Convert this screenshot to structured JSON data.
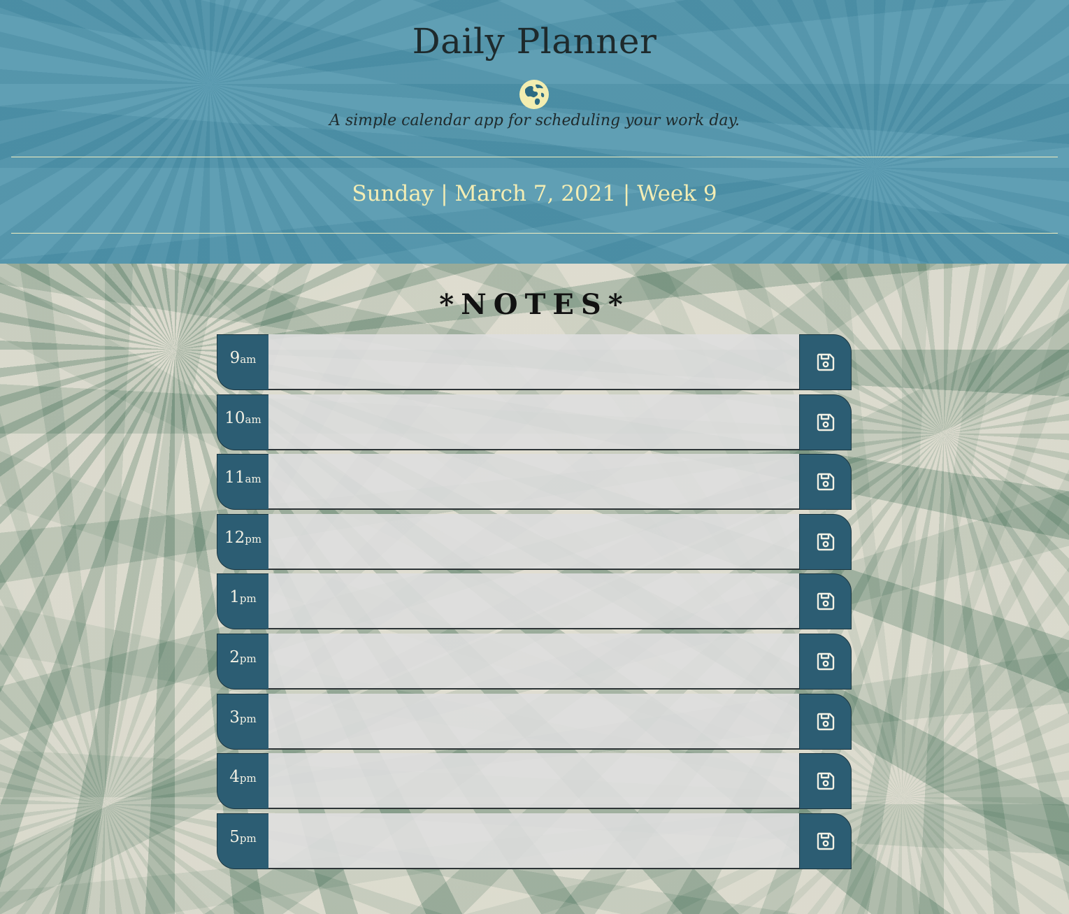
{
  "header": {
    "title": "Daily Planner",
    "icon": "globe-icon",
    "lead": "A simple calendar app for scheduling your work day.",
    "current_day": "Sunday | March 7, 2021 | Week 9"
  },
  "notes": {
    "heading": "*NOTES*"
  },
  "time_blocks": [
    {
      "hour": "9",
      "period": "am",
      "description": ""
    },
    {
      "hour": "10",
      "period": "am",
      "description": ""
    },
    {
      "hour": "11",
      "period": "am",
      "description": ""
    },
    {
      "hour": "12",
      "period": "pm",
      "description": ""
    },
    {
      "hour": "1",
      "period": "pm",
      "description": ""
    },
    {
      "hour": "2",
      "period": "pm",
      "description": ""
    },
    {
      "hour": "3",
      "period": "pm",
      "description": ""
    },
    {
      "hour": "4",
      "period": "pm",
      "description": ""
    },
    {
      "hour": "5",
      "period": "pm",
      "description": ""
    }
  ],
  "colors": {
    "header_bg": "#5397ae",
    "accent_dark": "#2c5d73",
    "date_text": "#f3edb4",
    "textarea_bg": "#dedede"
  }
}
